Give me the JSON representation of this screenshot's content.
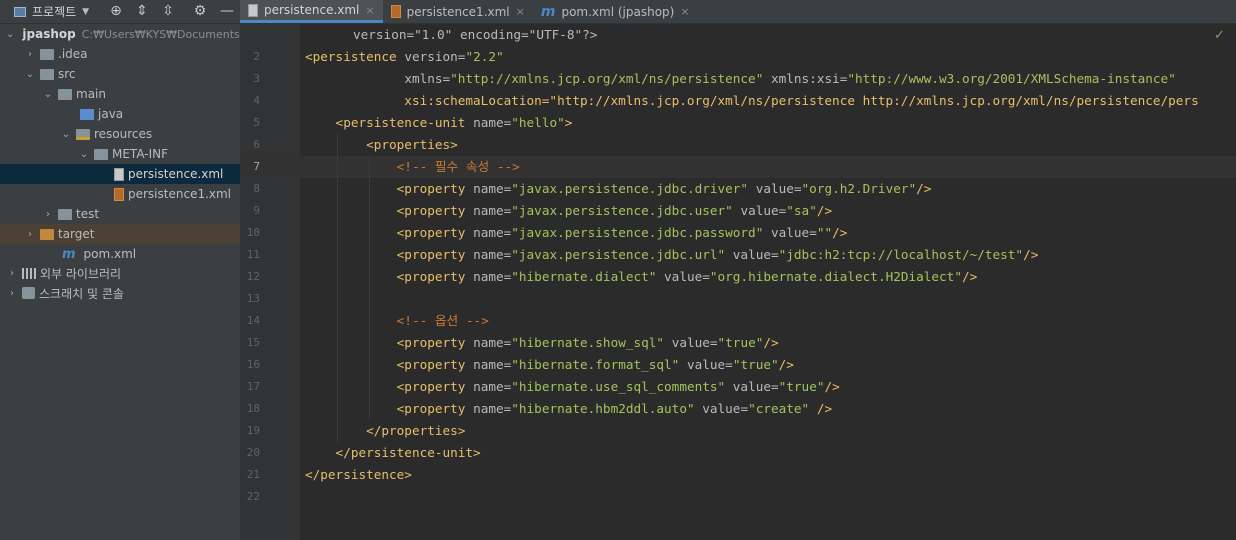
{
  "toolbar": {
    "project_view_label": "프로젝트",
    "icons": [
      "project-view-icon",
      "dropdown-icon",
      "crosshair-icon",
      "expand-all-icon",
      "collapse-all-icon",
      "gear-icon",
      "minimize-icon"
    ]
  },
  "tabs": [
    {
      "label": "persistence.xml",
      "close": "×",
      "active": true
    },
    {
      "label": "persistence1.xml",
      "close": "×",
      "active": false
    },
    {
      "label": "pom.xml (jpashop)",
      "close": "×",
      "active": false
    }
  ],
  "tab_icons": {
    "maven": "m"
  },
  "tree": {
    "root": {
      "label": "jpashop",
      "path": "C:₩Users₩KYS₩Documents₩GitHub₩jpashop"
    },
    "idea": ".idea",
    "src": "src",
    "main": "main",
    "java": "java",
    "resources": "resources",
    "metainf": "META-INF",
    "file1": "persistence.xml",
    "file2": "persistence1.xml",
    "test": "test",
    "target": "target",
    "pom": "pom.xml",
    "pom_icon": "m",
    "libs": "외부 라이브러리",
    "scratch": "스크래치 및 콘솔"
  },
  "editor": {
    "line_numbers": [
      "2",
      "3",
      "4",
      "5",
      "6",
      "7",
      "8",
      "9",
      "10",
      "11",
      "12",
      "13",
      "14",
      "15",
      "16",
      "17",
      "18",
      "19",
      "20",
      "21",
      "22"
    ],
    "line1_visible": "version=\"1.0\" encoding=\"UTF-8\"?>",
    "lines": [
      "<persistence version=\"2.2\"",
      "             xmlns=\"http://xmlns.jcp.org/xml/ns/persistence\" xmlns:xsi=\"http://www.w3.org/2001/XMLSchema-instance\"",
      "             xsi:schemaLocation=\"http://xmlns.jcp.org/xml/ns/persistence http://xmlns.jcp.org/xml/ns/persistence/pers",
      "    <persistence-unit name=\"hello\">",
      "        <properties>",
      "            <!-- 필수 속성 -->",
      "            <property name=\"javax.persistence.jdbc.driver\" value=\"org.h2.Driver\"/>",
      "            <property name=\"javax.persistence.jdbc.user\" value=\"sa\"/>",
      "            <property name=\"javax.persistence.jdbc.password\" value=\"\"/>",
      "            <property name=\"javax.persistence.jdbc.url\" value=\"jdbc:h2:tcp://localhost/~/test\"/>",
      "            <property name=\"hibernate.dialect\" value=\"org.hibernate.dialect.H2Dialect\"/>",
      "",
      "            <!-- 옵션 -->",
      "            <property name=\"hibernate.show_sql\" value=\"true\"/>",
      "            <property name=\"hibernate.format_sql\" value=\"true\"/>",
      "            <property name=\"hibernate.use_sql_comments\" value=\"true\"/>",
      "            <property name=\"hibernate.hbm2ddl.auto\" value=\"create\" />",
      "        </properties>",
      "    </persistence-unit>",
      "</persistence>",
      ""
    ],
    "check_mark": "✓"
  },
  "colors": {
    "tag": "#e8bf6a",
    "attr": "#bababa",
    "comment": "#cc7832",
    "accent": "#4a88c7",
    "selection": "#0d293e"
  }
}
